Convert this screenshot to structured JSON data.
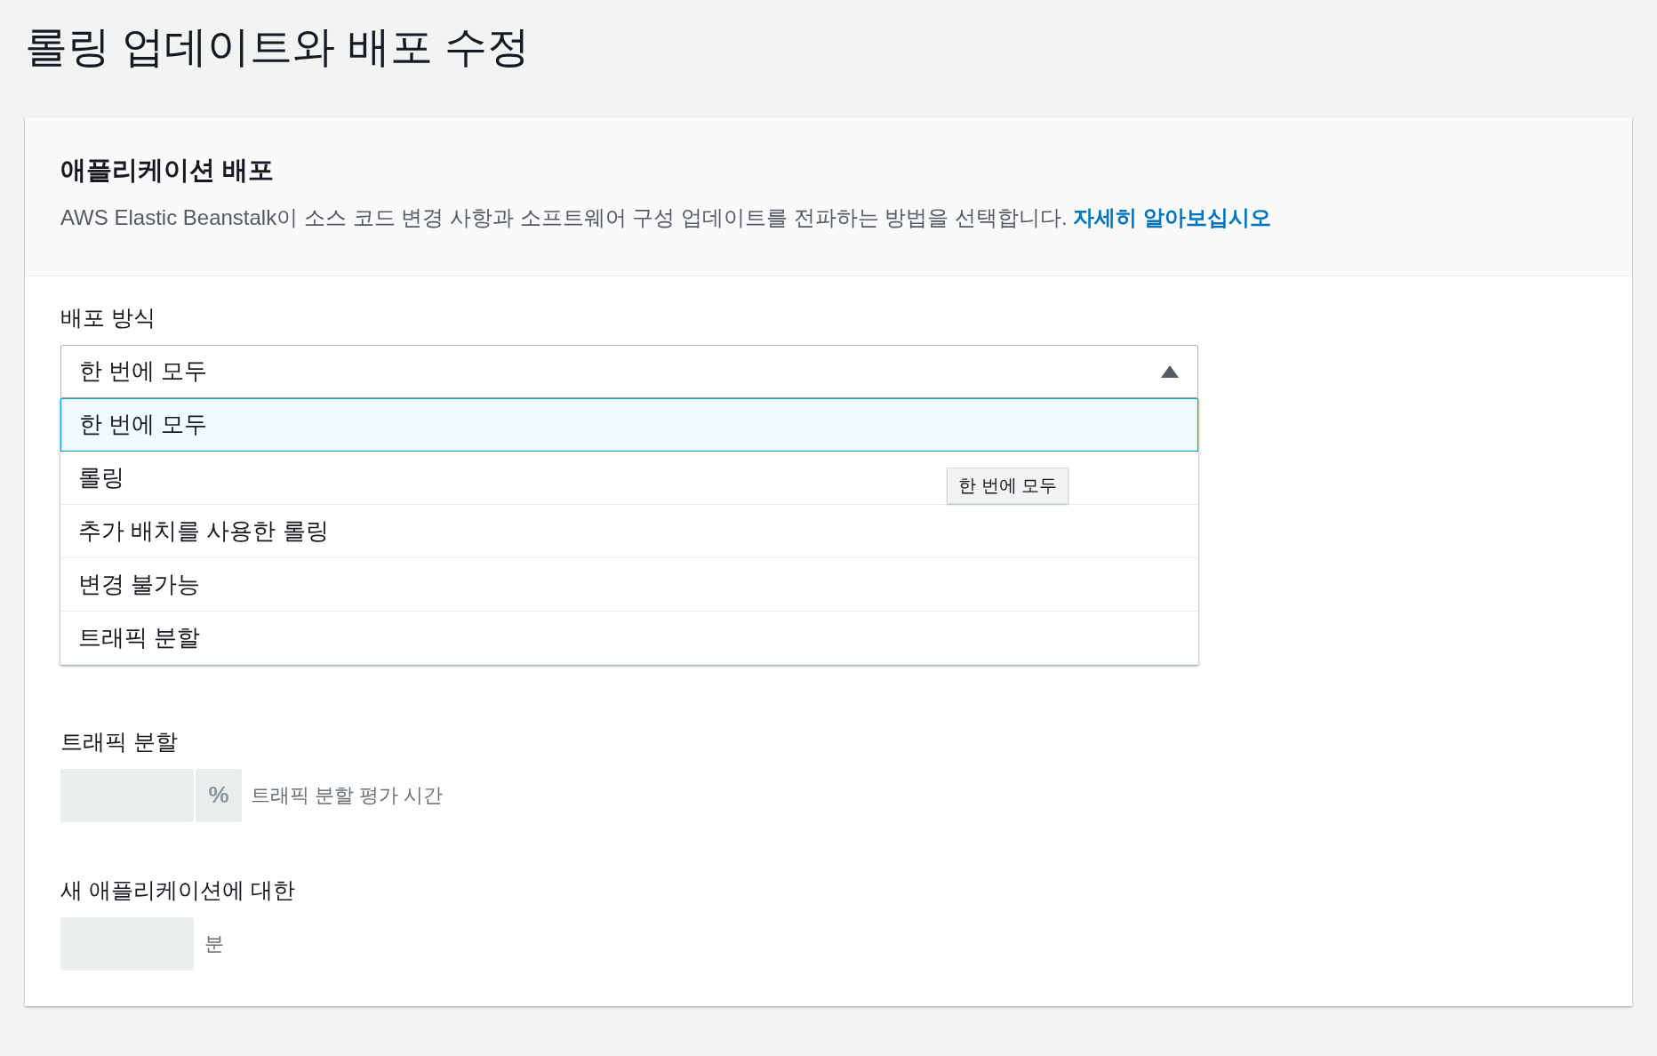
{
  "page": {
    "title": "롤링 업데이트와 배포 수정"
  },
  "section": {
    "title": "애플리케이션 배포",
    "description": "AWS Elastic Beanstalk이 소스 코드 변경 사항과 소프트웨어 구성 업데이트를 전파하는 방법을 선택합니다.",
    "link": "자세히 알아보십시오"
  },
  "deployment_policy": {
    "label": "배포 방식",
    "value": "한 번에 모두",
    "expanded": true,
    "options": [
      {
        "label": "한 번에 모두",
        "selected": true
      },
      {
        "label": "롤링",
        "selected": false
      },
      {
        "label": "추가 배치를 사용한 롤링",
        "selected": false
      },
      {
        "label": "변경 불가능",
        "selected": false
      },
      {
        "label": "트래픽 분할",
        "selected": false
      }
    ]
  },
  "tooltip": {
    "text": "한 번에 모두"
  },
  "traffic_split": {
    "label": "트래픽 분할",
    "unit": "%",
    "hint": "트래픽 분할 평가 시간",
    "disabled": true
  },
  "evaluation_time": {
    "label": "새 애플리케이션에 대한",
    "unit": "분",
    "disabled": true
  }
}
